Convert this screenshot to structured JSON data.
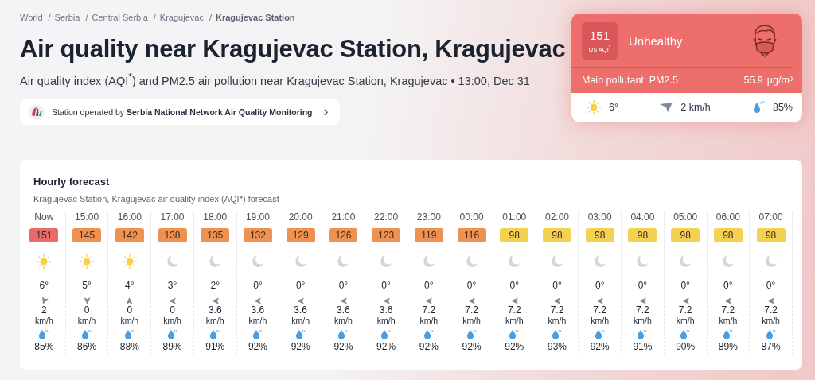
{
  "breadcrumb": [
    {
      "label": "World",
      "current": false
    },
    {
      "separator": "/",
      "label": "Serbia",
      "current": false
    },
    {
      "separator": "/",
      "label": "Central Serbia",
      "current": false
    },
    {
      "separator": "/",
      "label": "Kragujevac",
      "current": false
    },
    {
      "separator": "/",
      "label": "Kragujevac Station",
      "current": true
    }
  ],
  "title": "Air quality near Kragujevac Station, Kragujevac",
  "subtitle": "Air quality index (AQI$^{*}$) and PM2.5 air pollution near Kragujevac Station, Kragujevac • 13:00, Dec 31",
  "station": {
    "text": "Station operated by **Serbia National Network Air Quality Monitoring**",
    "chevron": "›"
  },
  "aqi_card": {
    "value": "151",
    "unit": "US AQI$^{*}$",
    "status": "Unhealthy",
    "color": "#ec6f6b",
    "pollutant": "Main pollutant: PM2.5",
    "concentration": "55.9",
    "conc_unit": "µg/m³",
    "temperature": "6°",
    "wind": "2 km/h",
    "humidity": "85%"
  },
  "forecast": {
    "title": "Hourly forecast",
    "subtitle": "Kragujevac Station, Kragujevac air quality index (AQI*) forecast",
    "hours": [
      {
        "time": "Now",
        "aqi": "151",
        "color": "#e86a69",
        "kind": "sun",
        "temp": "6°",
        "wind": {
          "kind": "southwest",
          "speed": "2",
          "unit": "km/h"
        },
        "humidity": "85%",
        "new_day": false
      },
      {
        "time": "15:00",
        "aqi": "145",
        "color": "#ef9150",
        "kind": "sun",
        "temp": "5°",
        "wind": {
          "kind": "south",
          "speed": "0",
          "unit": "km/h"
        },
        "humidity": "86%",
        "new_day": false
      },
      {
        "time": "16:00",
        "aqi": "142",
        "color": "#ef9150",
        "kind": "sun",
        "temp": "4°",
        "wind": {
          "kind": "north",
          "speed": "0",
          "unit": "km/h"
        },
        "humidity": "88%",
        "new_day": false
      },
      {
        "time": "17:00",
        "aqi": "138",
        "color": "#ef9150",
        "kind": "moon",
        "temp": "3°",
        "wind": {
          "kind": "west",
          "speed": "0",
          "unit": "km/h"
        },
        "humidity": "89%",
        "new_day": false
      },
      {
        "time": "18:00",
        "aqi": "135",
        "color": "#ef9150",
        "kind": "moon",
        "temp": "2°",
        "wind": {
          "kind": "west",
          "speed": "3.6",
          "unit": "km/h"
        },
        "humidity": "91%",
        "new_day": false
      },
      {
        "time": "19:00",
        "aqi": "132",
        "color": "#ef9150",
        "kind": "moon",
        "temp": "0°",
        "wind": {
          "kind": "west",
          "speed": "3.6",
          "unit": "km/h"
        },
        "humidity": "92%",
        "new_day": false
      },
      {
        "time": "20:00",
        "aqi": "129",
        "color": "#ef9150",
        "kind": "moon",
        "temp": "0°",
        "wind": {
          "kind": "west",
          "speed": "3.6",
          "unit": "km/h"
        },
        "humidity": "92%",
        "new_day": false
      },
      {
        "time": "21:00",
        "aqi": "126",
        "color": "#ef9150",
        "kind": "moon",
        "temp": "0°",
        "wind": {
          "kind": "west",
          "speed": "3.6",
          "unit": "km/h"
        },
        "humidity": "92%",
        "new_day": false
      },
      {
        "time": "22:00",
        "aqi": "123",
        "color": "#ef9150",
        "kind": "moon",
        "temp": "0°",
        "wind": {
          "kind": "west",
          "speed": "3.6",
          "unit": "km/h"
        },
        "humidity": "92%",
        "new_day": false
      },
      {
        "time": "23:00",
        "aqi": "119",
        "color": "#ef9150",
        "kind": "moon",
        "temp": "0°",
        "wind": {
          "kind": "west",
          "speed": "7.2",
          "unit": "km/h"
        },
        "humidity": "92%",
        "new_day": false
      },
      {
        "time": "00:00",
        "aqi": "116",
        "color": "#ef9150",
        "kind": "moon",
        "temp": "0°",
        "wind": {
          "kind": "west",
          "speed": "7.2",
          "unit": "km/h"
        },
        "humidity": "92%",
        "new_day": true
      },
      {
        "time": "01:00",
        "aqi": "98",
        "color": "#f5d151",
        "kind": "moon",
        "temp": "0°",
        "wind": {
          "kind": "west",
          "speed": "7.2",
          "unit": "km/h"
        },
        "humidity": "92%",
        "new_day": false
      },
      {
        "time": "02:00",
        "aqi": "98",
        "color": "#f5d151",
        "kind": "moon",
        "temp": "0°",
        "wind": {
          "kind": "west",
          "speed": "7.2",
          "unit": "km/h"
        },
        "humidity": "93%",
        "new_day": false
      },
      {
        "time": "03:00",
        "aqi": "98",
        "color": "#f5d151",
        "kind": "moon",
        "temp": "0°",
        "wind": {
          "kind": "west",
          "speed": "7.2",
          "unit": "km/h"
        },
        "humidity": "92%",
        "new_day": false
      },
      {
        "time": "04:00",
        "aqi": "98",
        "color": "#f5d151",
        "kind": "moon",
        "temp": "0°",
        "wind": {
          "kind": "west",
          "speed": "7.2",
          "unit": "km/h"
        },
        "humidity": "91%",
        "new_day": false
      },
      {
        "time": "05:00",
        "aqi": "98",
        "color": "#f5d151",
        "kind": "moon",
        "temp": "0°",
        "wind": {
          "kind": "west",
          "speed": "7.2",
          "unit": "km/h"
        },
        "humidity": "90%",
        "new_day": false
      },
      {
        "time": "06:00",
        "aqi": "98",
        "color": "#f5d151",
        "kind": "moon",
        "temp": "0°",
        "wind": {
          "kind": "west",
          "speed": "7.2",
          "unit": "km/h"
        },
        "humidity": "89%",
        "new_day": false
      },
      {
        "time": "07:00",
        "aqi": "98",
        "color": "#f5d151",
        "kind": "moon",
        "temp": "0°",
        "wind": {
          "kind": "west",
          "speed": "7.2",
          "unit": "km/h"
        },
        "humidity": "87%",
        "new_day": false
      }
    ]
  }
}
